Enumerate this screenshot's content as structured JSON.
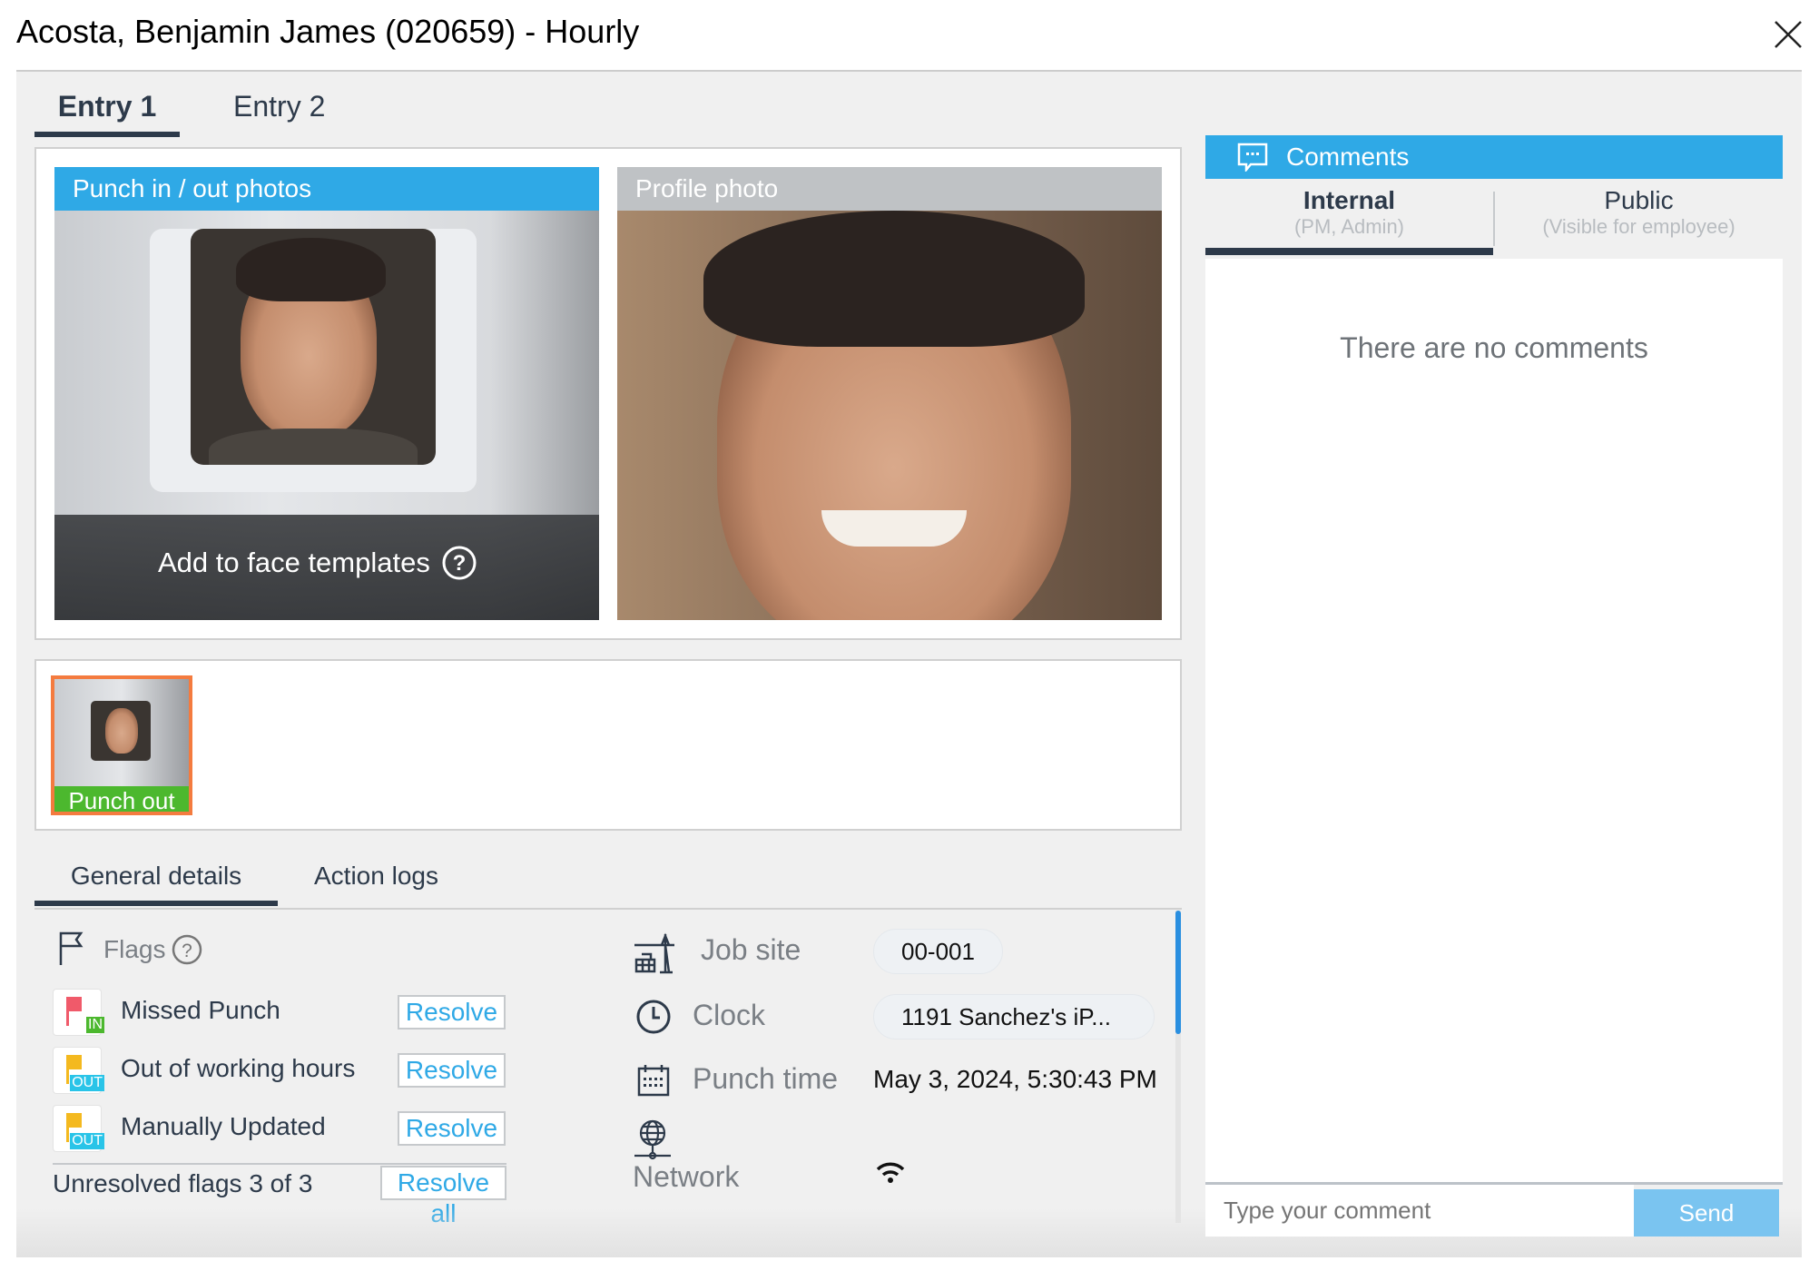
{
  "header": {
    "title": "Acosta, Benjamin James (020659) - Hourly",
    "close_icon": "close-icon"
  },
  "entry_tabs": [
    {
      "label": "Entry 1",
      "active": true
    },
    {
      "label": "Entry 2",
      "active": false
    }
  ],
  "photos": {
    "punch_title": "Punch in / out photos",
    "profile_title": "Profile photo",
    "add_face_label": "Add to face templates",
    "accent": "#2fa9e6"
  },
  "thumbnails": [
    {
      "label": "Punch out",
      "border_color": "#f47b3f",
      "label_color": "#4cb82e"
    }
  ],
  "detail_tabs": [
    {
      "label": "General details",
      "active": true
    },
    {
      "label": "Action logs",
      "active": false
    }
  ],
  "flags": {
    "title": "Flags",
    "items": [
      {
        "label": "Missed Punch",
        "badge": "IN",
        "flag_color": "#f05a6a",
        "badge_color": "#4cb82e",
        "action": "Resolve"
      },
      {
        "label": "Out of working hours",
        "badge": "OUT",
        "flag_color": "#f4b91f",
        "badge_color": "#29c4e8",
        "action": "Resolve"
      },
      {
        "label": "Manually Updated",
        "badge": "OUT",
        "flag_color": "#f4b91f",
        "badge_color": "#29c4e8",
        "action": "Resolve"
      }
    ],
    "summary": "Unresolved flags 3 of 3",
    "resolve_all": "Resolve all"
  },
  "details": {
    "job_site_label": "Job site",
    "job_site_value": "00-001",
    "clock_label": "Clock",
    "clock_value": "1191 Sanchez's iP...",
    "punch_time_label": "Punch time",
    "punch_time_value": "May 3, 2024, 5:30:43 PM",
    "network_label": "Network",
    "network_icon": "wifi-icon"
  },
  "comments": {
    "title": "Comments",
    "tabs": [
      {
        "label": "Internal",
        "sub": "(PM, Admin)",
        "active": true
      },
      {
        "label": "Public",
        "sub": "(Visible for employee)",
        "active": false
      }
    ],
    "empty": "There are no comments",
    "input_placeholder": "Type your comment",
    "send": "Send"
  }
}
